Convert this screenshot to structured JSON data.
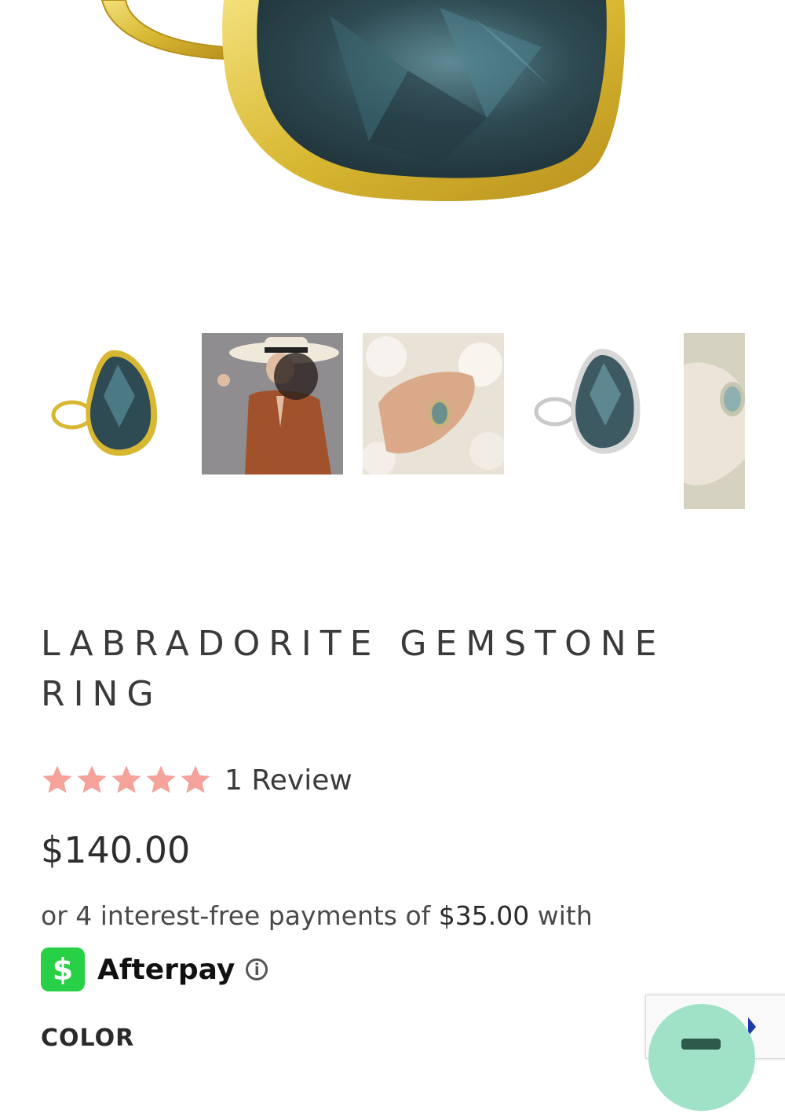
{
  "product": {
    "title": "LABRADORITE GEMSTONE RING",
    "rating": 5,
    "review_count_label": "1 Review",
    "price": "$140.00",
    "installment_prefix": "or 4 interest-free payments of",
    "installment_amount": "$35.00",
    "installment_suffix": "with",
    "afterpay_logo_glyph": "$",
    "afterpay_label": "Afterpay",
    "afterpay_info_glyph": "i",
    "color_label": "COLOR"
  },
  "colors": {
    "star": "#f4a29a",
    "afterpay_green": "#28d045",
    "gold": "#d8b832",
    "stone": "#2e4a52",
    "chat_button": "#9fe2c8"
  },
  "gallery": {
    "thumbnails": [
      {
        "name": "gold-ring-thumbnail"
      },
      {
        "name": "model-hat-thumbnail"
      },
      {
        "name": "hand-flowers-thumbnail"
      },
      {
        "name": "silver-ring-thumbnail"
      },
      {
        "name": "video-thumbnail"
      }
    ]
  }
}
